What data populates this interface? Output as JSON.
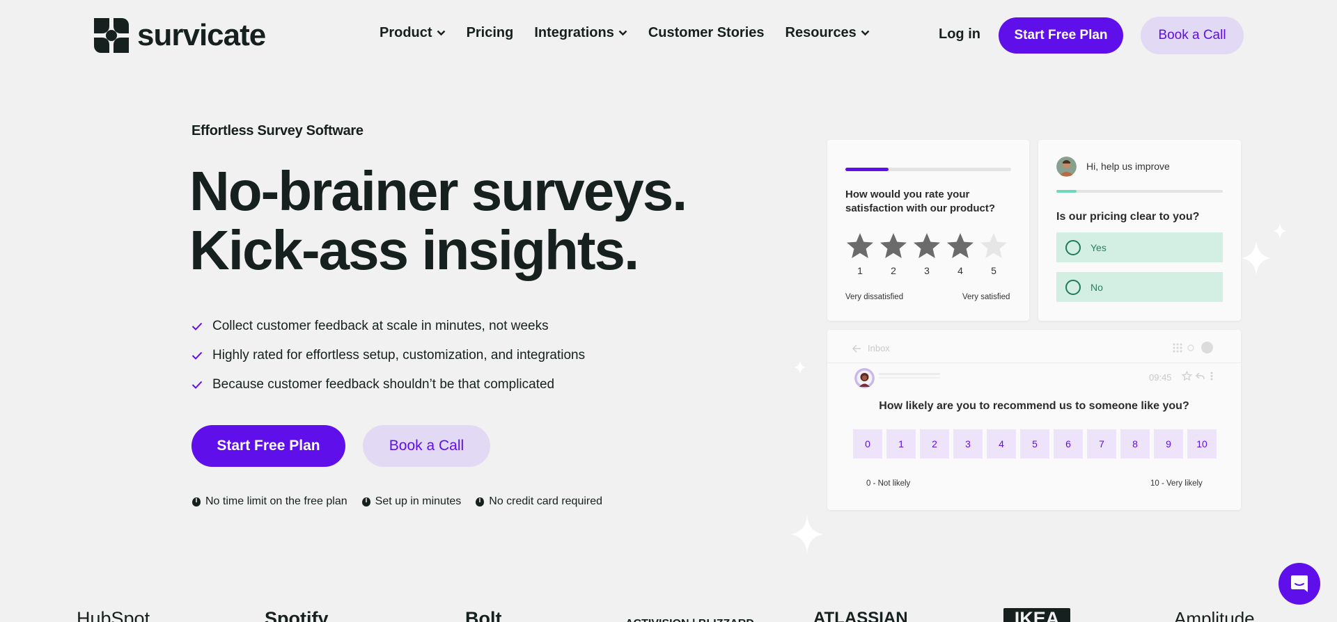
{
  "colors": {
    "accent": "#5f0fe9",
    "accent_soft": "#e2d9f5",
    "teal": "#6fd9c0",
    "text": "#16201e",
    "bg": "#f1f1f1"
  },
  "header": {
    "logo_text": "survicate",
    "nav": [
      {
        "label": "Product",
        "has_dropdown": true
      },
      {
        "label": "Pricing",
        "has_dropdown": false
      },
      {
        "label": "Integrations",
        "has_dropdown": true
      },
      {
        "label": "Customer Stories",
        "has_dropdown": false
      },
      {
        "label": "Resources",
        "has_dropdown": true
      }
    ],
    "login": "Log in",
    "cta_primary": "Start Free Plan",
    "cta_secondary": "Book a Call"
  },
  "hero": {
    "eyebrow": "Effortless Survey Software",
    "headline_1": "No-brainer surveys.",
    "headline_2": "Kick-ass insights.",
    "features": [
      "Collect customer feedback at scale in minutes, not weeks",
      "Highly rated for effortless setup, customization, and integrations",
      "Because customer feedback shouldn’t be that complicated"
    ],
    "cta_primary": "Start Free Plan",
    "cta_secondary": "Book a Call",
    "perks": [
      "No time limit on the free plan",
      "Set up in minutes",
      "No credit card required"
    ]
  },
  "rating_card": {
    "progress": 0.26,
    "question": "How would you rate your satisfaction with our product?",
    "rating": 4,
    "max": 5,
    "numbers": [
      "1",
      "2",
      "3",
      "4",
      "5"
    ],
    "low_label": "Very dissatisfied",
    "high_label": "Very satisfied"
  },
  "pricing_card": {
    "greeting": "Hi, help us improve",
    "progress": 0.12,
    "question": "Is our pricing clear to you?",
    "options": [
      "Yes",
      "No"
    ]
  },
  "nps_card": {
    "inbox_label": "Inbox",
    "time": "09:45",
    "question": "How likely are you to recommend us to someone like you?",
    "scale": [
      "0",
      "1",
      "2",
      "3",
      "4",
      "5",
      "6",
      "7",
      "8",
      "9",
      "10"
    ],
    "low_label": "0 - Not likely",
    "high_label": "10 - Very likely"
  },
  "logos": [
    "HubSpot",
    "Spotify",
    "Bolt",
    "ACTIVISION | BLIZZARD",
    "ATLASSIAN",
    "IKEA",
    "Amplitude"
  ],
  "icons": {
    "check": "check-icon",
    "perk": "leaf-icon",
    "chevron": "chevron-down-icon",
    "chat": "chat-icon",
    "sparkle": "sparkle-icon"
  }
}
